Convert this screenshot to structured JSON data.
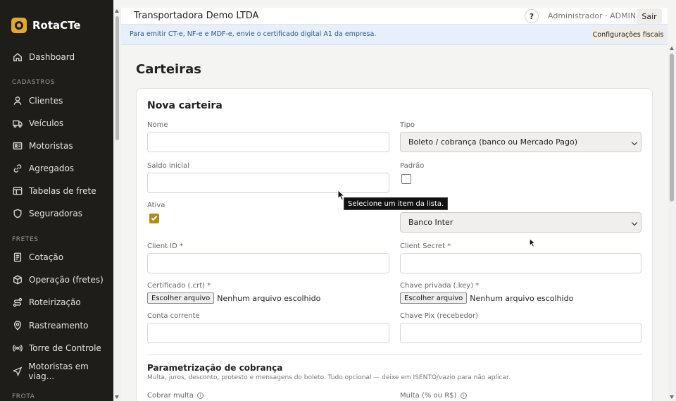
{
  "brand": {
    "name": "RotaCTe"
  },
  "sidebar": {
    "dashboard": "Dashboard",
    "section_cadastros": "CADASTROS",
    "cadastros": [
      "Clientes",
      "Veículos",
      "Motoristas",
      "Agregados",
      "Tabelas de frete",
      "Seguradoras"
    ],
    "section_fretes": "FRETES",
    "fretes": [
      "Cotação",
      "Operação (fretes)",
      "Roteirização",
      "Rastreamento",
      "Torre de Controle",
      "Motoristas em viag..."
    ],
    "section_frota": "FROTA"
  },
  "topbar": {
    "company": "Transportadora Demo LTDA",
    "help": "?",
    "user": "Administrador · ADMIN",
    "logout": "Sair"
  },
  "banner": {
    "text": "Para emitir CT-e, NF-e e MDF-e, envie o certificado digital A1 da empresa.",
    "button": "Configurações fiscais"
  },
  "page": {
    "title": "Carteiras"
  },
  "form": {
    "title": "Nova carteira",
    "nome_label": "Nome",
    "tipo_label": "Tipo",
    "tipo_value": "Boleto / cobrança (banco ou Mercado Pago)",
    "saldo_label": "Saldo inicial",
    "padrao_label": "Padrão",
    "ativa_label": "Ativa",
    "banco_value": "Banco Inter",
    "client_id_label": "Client ID *",
    "client_secret_label": "Client Secret *",
    "cert_label": "Certificado (.crt) *",
    "key_label": "Chave privada (.key) *",
    "file_button": "Escolher arquivo",
    "file_none": "Nenhum arquivo escolhido",
    "conta_label": "Conta corrente",
    "pix_label": "Chave Pix (recebedor)",
    "section_title": "Parametrização de cobrança",
    "section_subtitle": "Multa, juros, desconto, protesto e mensagens do boleto. Tudo opcional — deixe em ISENTO/vazio para não aplicar.",
    "multa_label": "Cobrar multa",
    "multa_pct_label": "Multa (% ou R$)",
    "info_glyph": "i"
  },
  "tooltip": {
    "text": "Selecione um item da lista."
  }
}
